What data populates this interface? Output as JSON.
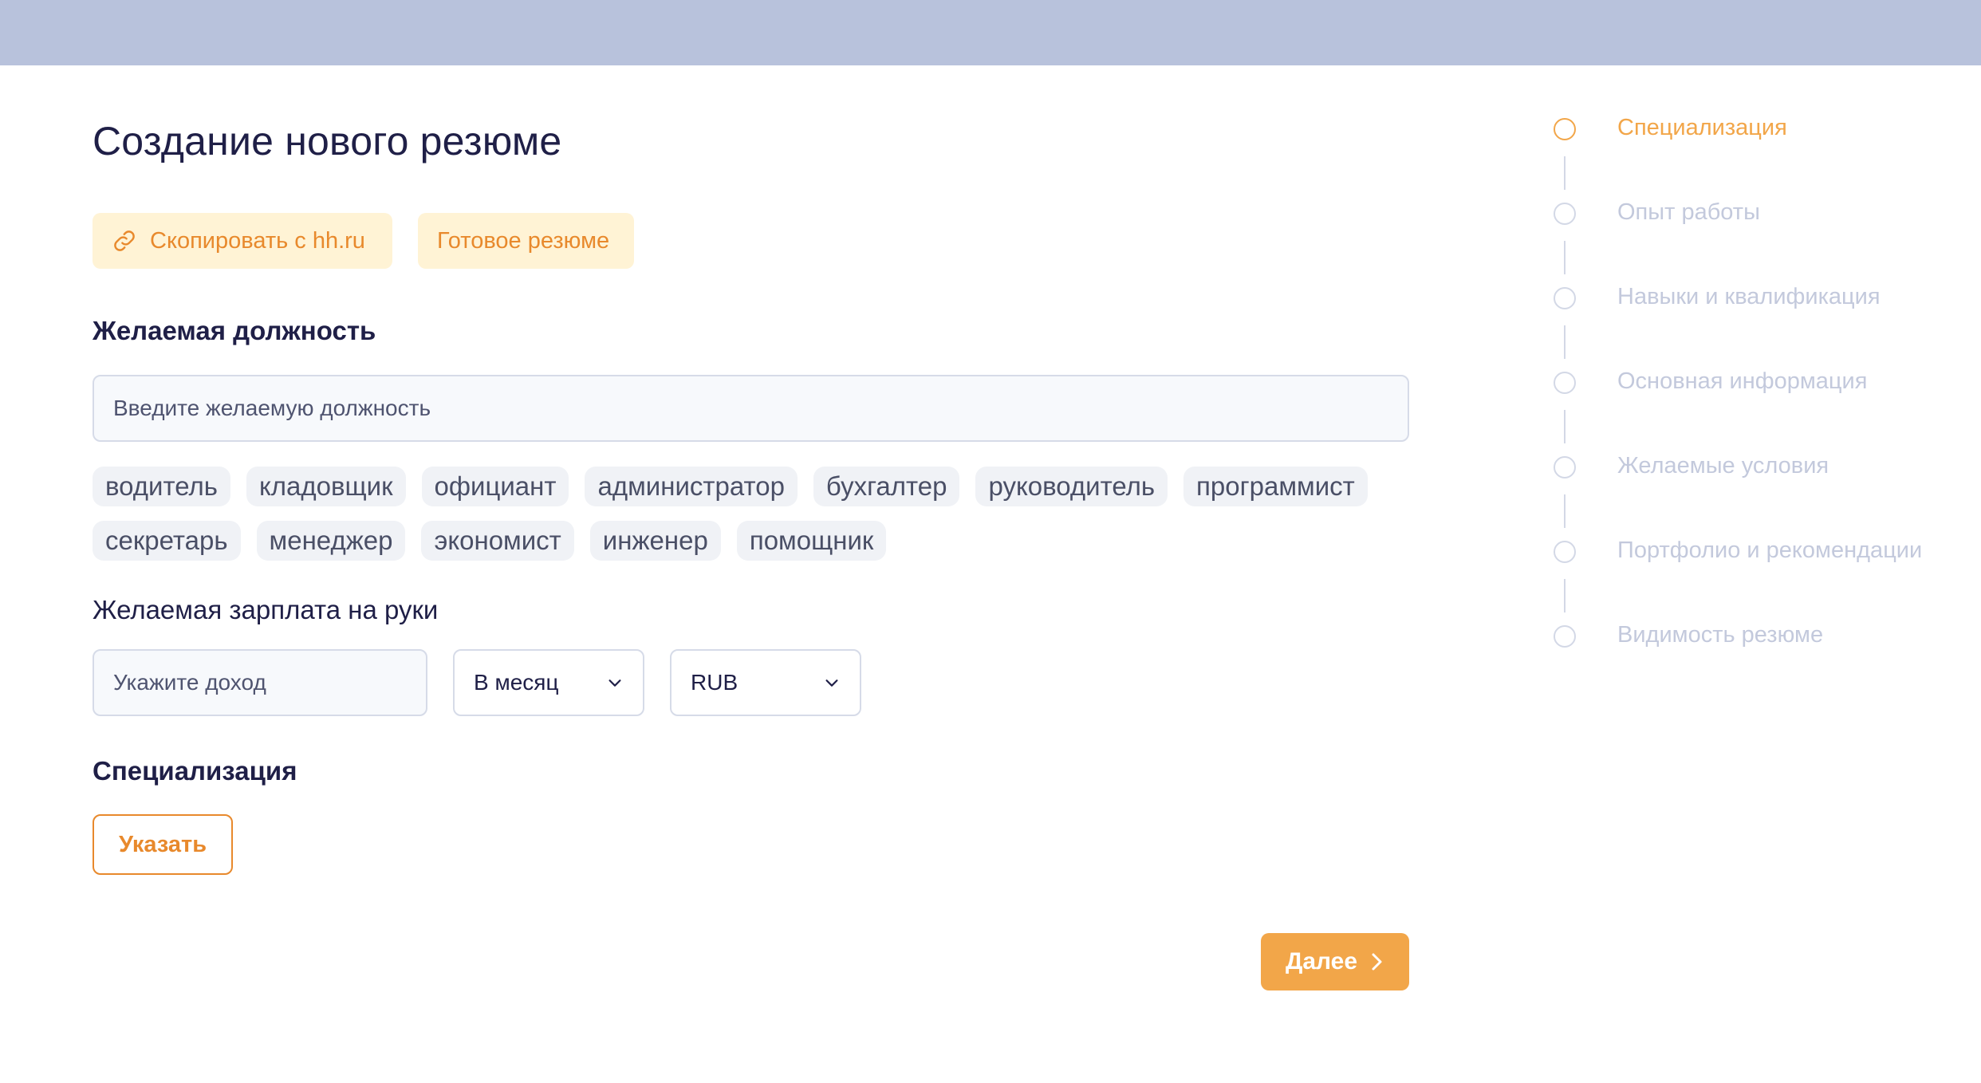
{
  "page": {
    "title": "Создание нового резюме"
  },
  "actions": {
    "copy_label": "Скопировать с hh.ru",
    "ready_label": "Готовое резюме"
  },
  "position": {
    "label": "Желаемая должность",
    "placeholder": "Введите желаемую должность",
    "suggestions_row1": [
      "водитель",
      "кладовщик",
      "официант",
      "администратор",
      "бухгалтер",
      "руководитель",
      "программист"
    ],
    "suggestions_row2": [
      "секретарь",
      "менеджер",
      "экономист",
      "инженер",
      "помощник"
    ]
  },
  "salary": {
    "label": "Желаемая зарплата на руки",
    "placeholder": "Укажите доход",
    "period_selected": "В месяц",
    "currency_selected": "RUB"
  },
  "specialization": {
    "label": "Специализация",
    "button_label": "Указать"
  },
  "footer": {
    "next_label": "Далее"
  },
  "steps": [
    {
      "label": "Специализация",
      "active": true
    },
    {
      "label": "Опыт работы",
      "active": false
    },
    {
      "label": "Навыки и квалификация",
      "active": false
    },
    {
      "label": "Основная информация",
      "active": false
    },
    {
      "label": "Желаемые условия",
      "active": false
    },
    {
      "label": "Портфолио и рекомендации",
      "active": false
    },
    {
      "label": "Видимость резюме",
      "active": false
    }
  ],
  "colors": {
    "accent": "#f2a649",
    "accent_text": "#e8892c",
    "topbar": "#b8c2dc",
    "heading": "#1f1f47"
  },
  "icons": {
    "copy": "link-icon",
    "select": "chevron-down-icon",
    "next": "chevron-right-icon"
  }
}
